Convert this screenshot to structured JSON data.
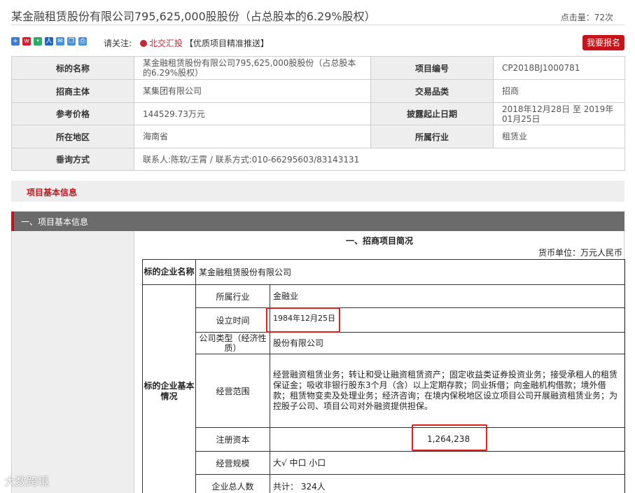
{
  "header": {
    "title": "某金融租赁股份有限公司795,625,000股股份（占总股本的6.29%股权）",
    "views": "点击量：72次"
  },
  "share": {
    "icons": [
      "plus-icon",
      "weibo-icon",
      "wechat-icon",
      "renren-icon",
      "mail-icon",
      "copy-icon",
      "print-icon"
    ],
    "follow_label": "请关注:",
    "follow_link": "北交汇投",
    "follow_tag": "【优质项目精准推送】",
    "register_label": "我要报名",
    "accent_color": "#c7141b"
  },
  "info": {
    "rows": [
      {
        "k1": "标的名称",
        "v1": "某金融租赁股份有限公司795,625,000股股份（占总股本的6.29%股权）",
        "k2": "项目编号",
        "v2": "CP2018BJ1000781"
      },
      {
        "k1": "招商主体",
        "v1": "某集团有限公司",
        "k2": "交易品类",
        "v2": "招商"
      },
      {
        "k1": "参考价格",
        "v1": "144529.73万元",
        "k2": "披露起止日期",
        "v2": "2018年12月28日 至 2019年01月25日"
      },
      {
        "k1": "所在地区",
        "v1": "海南省",
        "k2": "所属行业",
        "v2": "租赁业"
      },
      {
        "k1": "垂询方式",
        "v1": "联系人:陈软/王霄 / 联系方式:010-66295603/83143131"
      }
    ]
  },
  "section_tab": "项目基本信息",
  "section_bar": "一、项目基本信息",
  "detail": {
    "title": "一、招商项目简况",
    "currency": "货币单位：万元人民币",
    "company_label": "标的企业名称",
    "company_value": "某金融租赁股份有限公司",
    "group_label": "标的企业基本情况",
    "rows": [
      {
        "label": "所属行业",
        "value": "金融业"
      },
      {
        "label": "设立时间",
        "value": "1984年12月25日"
      },
      {
        "label": "公司类型（经济性质）",
        "value": "股份有限公司"
      },
      {
        "label": "经营范围",
        "value": "经营融资租赁业务；转让和受让融资租赁资产；固定收益类证券投资业务；接受承租人的租赁保证金；吸收非银行股东3个月（含）以上定期存款；同业拆借；向金融机构借款；境外借款；租赁物变卖及处理业务；经济咨询；在境内保税地区设立项目公司开展融资租赁业务；为控股子公司、项目公司对外融资提供担保。"
      },
      {
        "label": "注册资本",
        "value": "1,264,238"
      },
      {
        "label": "经营规模",
        "value": "大√ 中口 小口"
      },
      {
        "label": "企业总人数",
        "value": "共计： 324人"
      }
    ]
  },
  "watermark": "大数跨境"
}
